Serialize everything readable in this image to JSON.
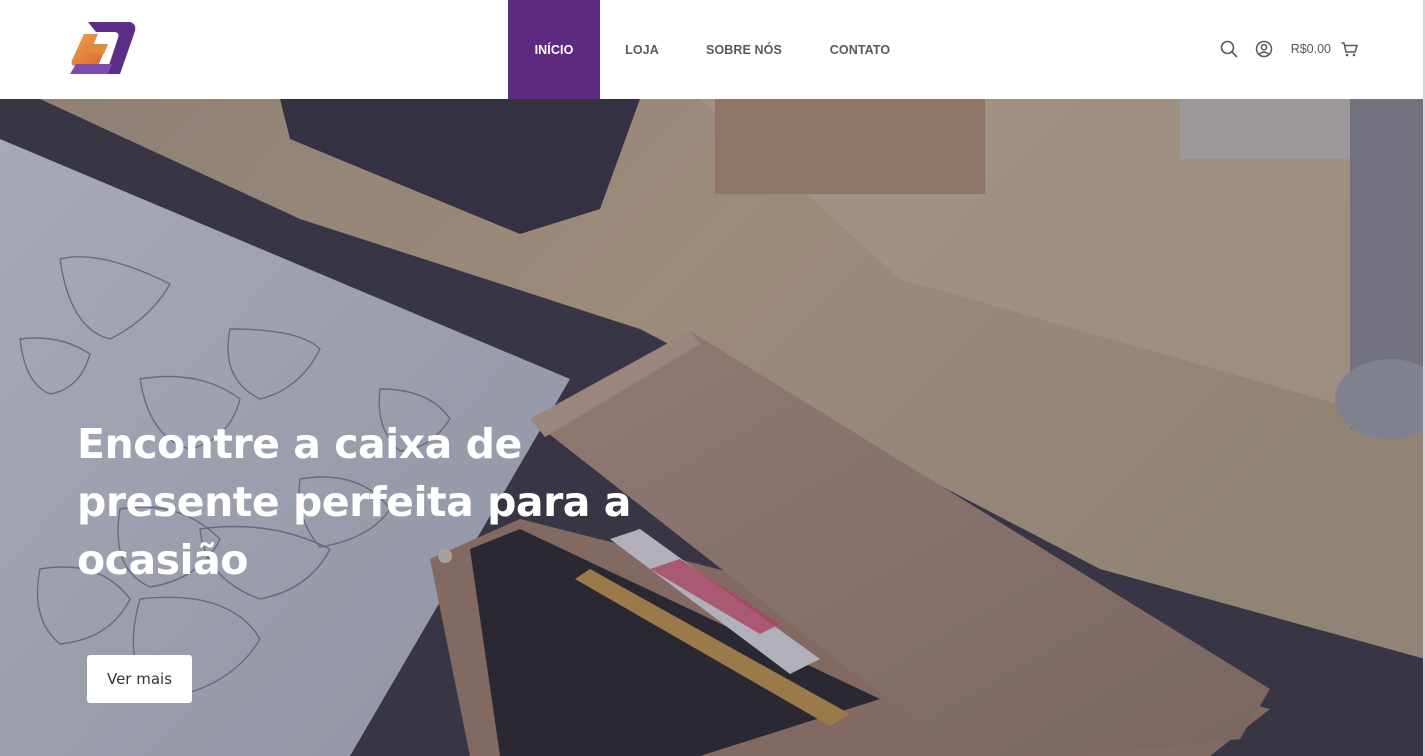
{
  "header": {
    "logo_icon": "brand-logo-icon",
    "nav": {
      "inicio": "INÍCIO",
      "loja": "LOJA",
      "sobre": "SOBRE NÓS",
      "contato": "CONTATO"
    },
    "cart_total": "R$0.00",
    "icons": {
      "search": "search-icon",
      "account": "user-icon",
      "cart": "cart-icon"
    }
  },
  "hero": {
    "title": "Encontre a caixa de presente perfeita para a ocasião",
    "button_label": "Ver mais"
  },
  "colors": {
    "brand_purple": "#5e2a80",
    "brand_orange": "#e8963a",
    "nav_text": "#555a60"
  }
}
